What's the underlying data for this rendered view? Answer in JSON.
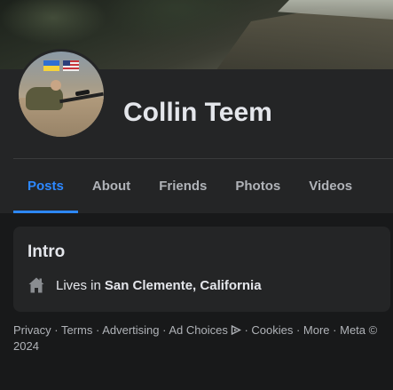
{
  "profile": {
    "name": "Collin Teem"
  },
  "tabs": [
    {
      "label": "Posts",
      "active": true
    },
    {
      "label": "About"
    },
    {
      "label": "Friends"
    },
    {
      "label": "Photos"
    },
    {
      "label": "Videos"
    }
  ],
  "intro": {
    "title": "Intro",
    "lives_prefix": "Lives in",
    "location": "San Clemente, California",
    "icon": "home-icon"
  },
  "footer": {
    "privacy": "Privacy",
    "terms": "Terms",
    "advertising": "Advertising",
    "ad_choices": "Ad Choices",
    "cookies": "Cookies",
    "more": "More",
    "meta": "Meta © 2024",
    "separator": " · "
  },
  "colors": {
    "background": "#18191a",
    "card": "#242526",
    "accent": "#2d88ff",
    "text_primary": "#e4e6eb",
    "text_secondary": "#b0b3b8"
  }
}
